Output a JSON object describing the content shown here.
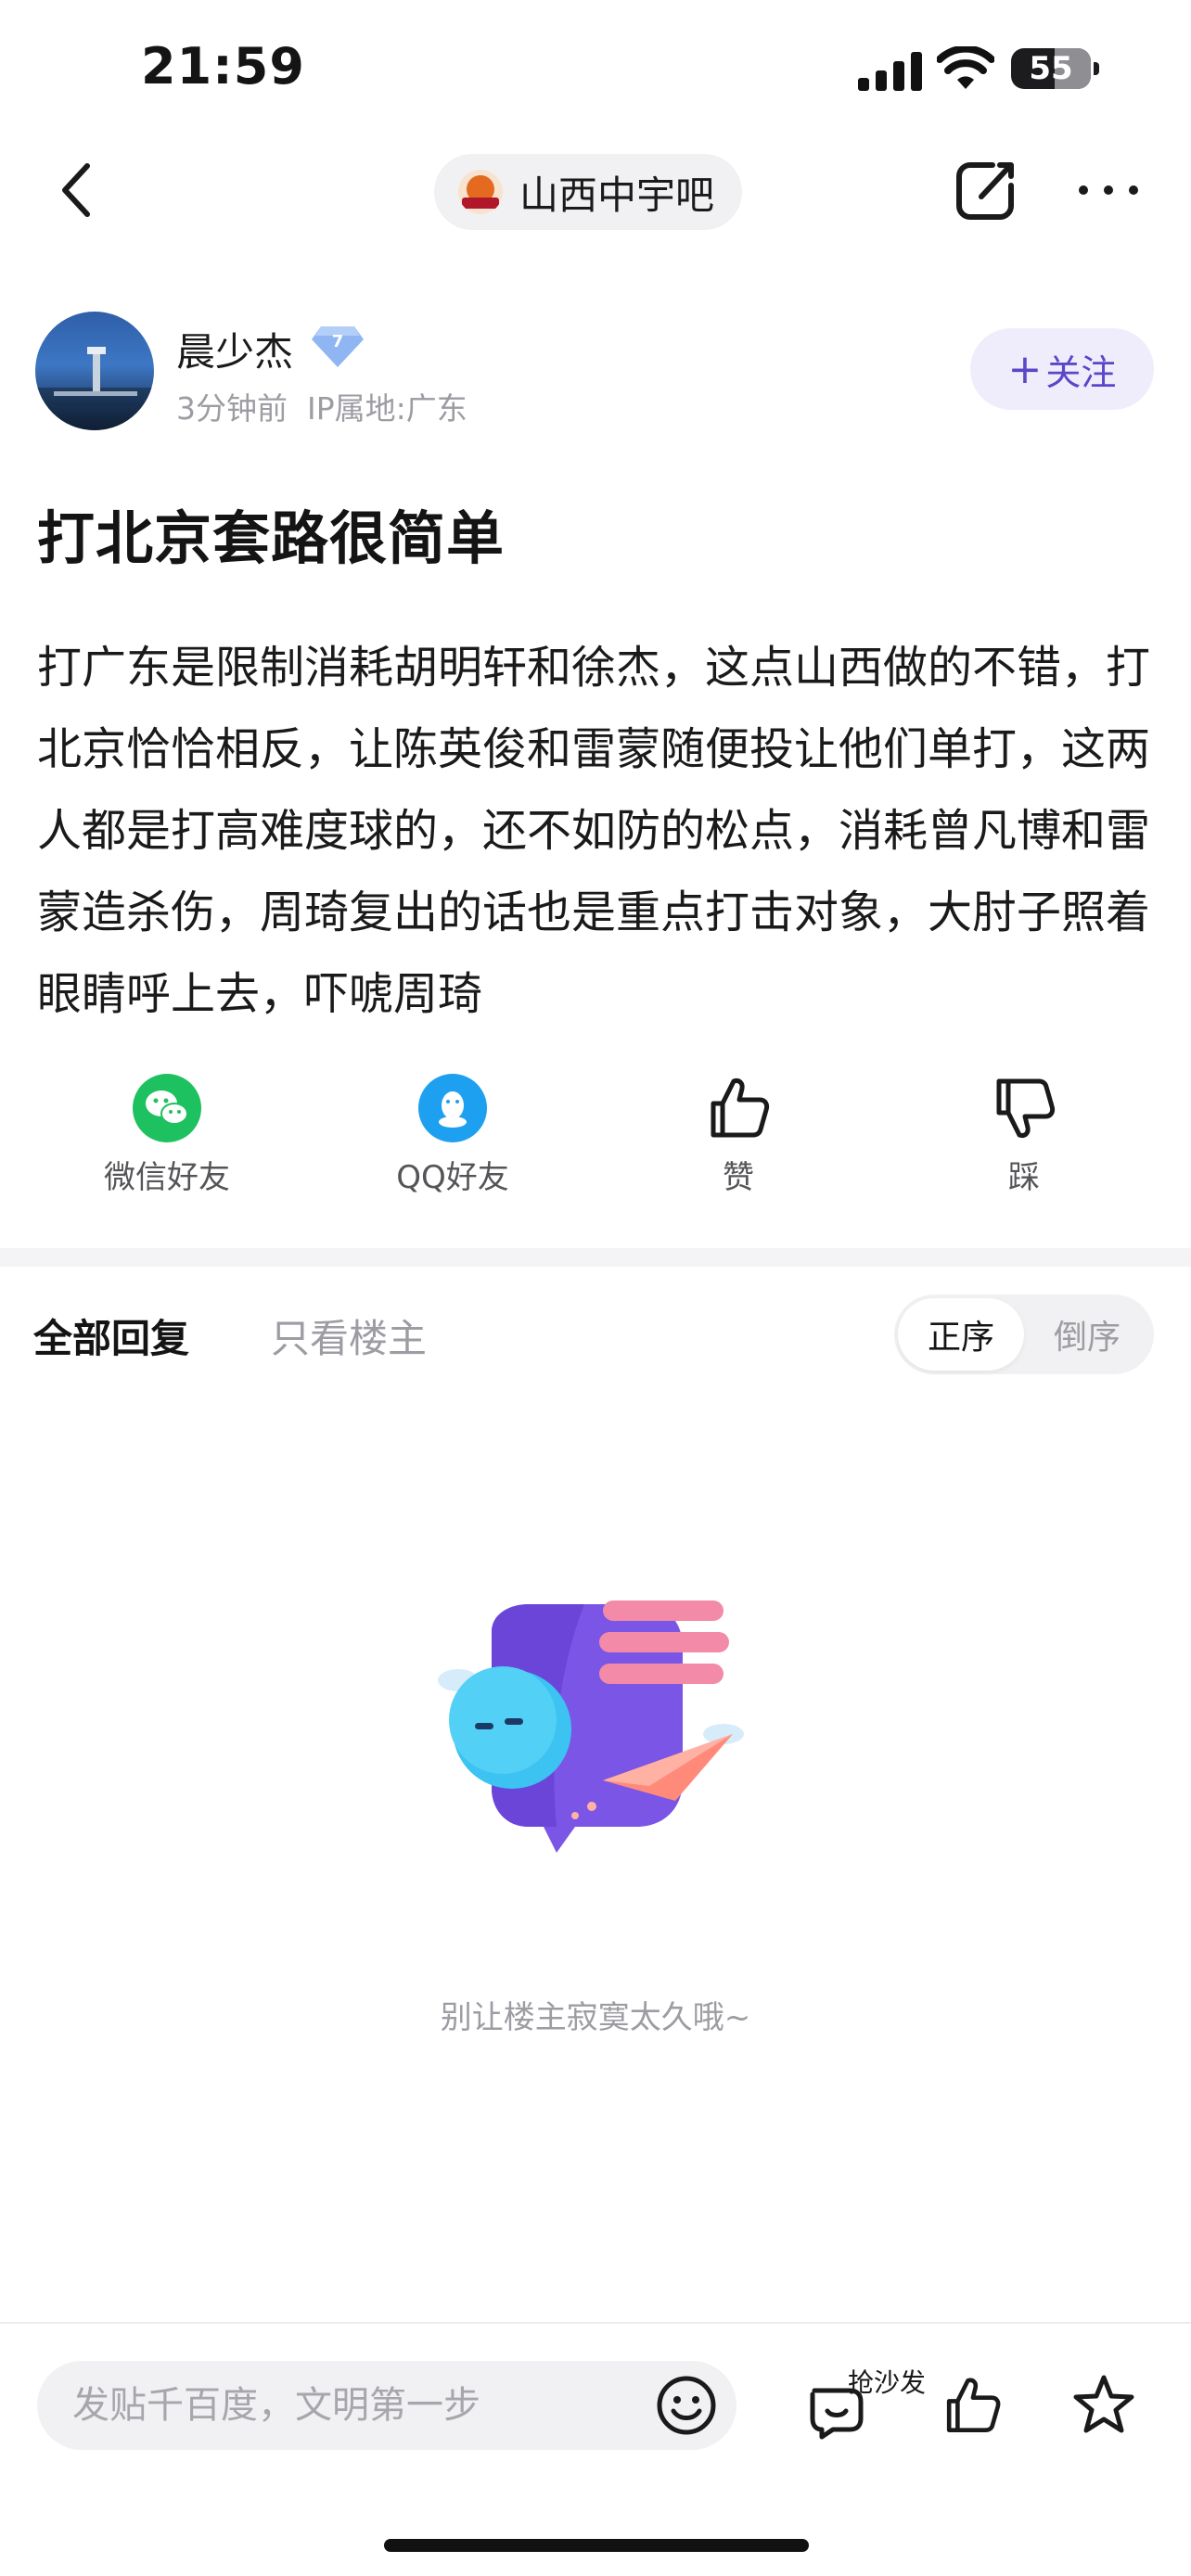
{
  "status_bar": {
    "time": "21:59",
    "battery": "55",
    "battery_level_percent": 55
  },
  "nav": {
    "forum_name": "山西中宇吧",
    "forum_logo_icon": "basketball-team-logo-icon",
    "back_icon": "chevron-left-icon",
    "edit_icon": "edit-share-icon",
    "more_icon": "more-dots-icon"
  },
  "author": {
    "name": "晨少杰",
    "level": "7",
    "time_ago": "3分钟前",
    "ip_location": "IP属地:广东",
    "follow_label": "关注"
  },
  "post": {
    "title": "打北京套路很简单",
    "body": "打广东是限制消耗胡明轩和徐杰，这点山西做的不错，打北京恰恰相反，让陈英俊和雷蒙随便投让他们单打，这两人都是打高难度球的，还不如防的松点，消耗曾凡博和雷蒙造杀伤，周琦复出的话也是重点打击对象，大肘子照着眼睛呼上去，吓唬周琦"
  },
  "actions": [
    {
      "label": "微信好友",
      "icon": "wechat-icon"
    },
    {
      "label": "QQ好友",
      "icon": "qq-icon"
    },
    {
      "label": "赞",
      "icon": "thumbs-up-icon"
    },
    {
      "label": "踩",
      "icon": "thumbs-down-icon"
    }
  ],
  "replies": {
    "tab_all": "全部回复",
    "tab_owner_only": "只看楼主",
    "sort_asc": "正序",
    "sort_desc": "倒序",
    "empty_text": "别让楼主寂寞太久哦~"
  },
  "bottom_bar": {
    "input_placeholder": "发贴千百度，文明第一步",
    "sofa_label": "抢沙发"
  },
  "colors": {
    "accent": "#5b47c7",
    "follow_bg": "#efedfb",
    "wechat": "#1ec15f",
    "qq": "#1ea0f0",
    "muted_text": "#9c9ca3"
  }
}
